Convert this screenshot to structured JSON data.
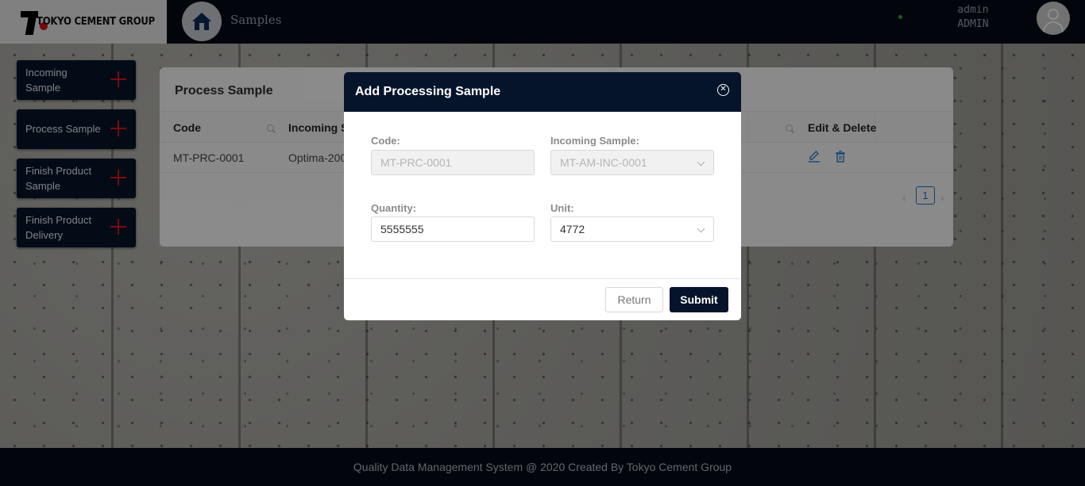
{
  "header": {
    "logo_text": "TOKYO CEMENT GROUP",
    "breadcrumb": "Samples",
    "user_name": "admin",
    "user_role": "ADMIN"
  },
  "sidebar": {
    "items": [
      {
        "label": "Incoming Sample"
      },
      {
        "label": "Process Sample"
      },
      {
        "label": "Finish Product Sample"
      },
      {
        "label": "Finish Product Delivery"
      }
    ]
  },
  "card": {
    "title": "Process Sample",
    "columns": [
      "Code",
      "Incoming S",
      "Edit & Delete"
    ],
    "rows": [
      {
        "code": "MT-PRC-0001",
        "incoming": "Optima-200"
      }
    ],
    "pagination": {
      "current_page": "1"
    }
  },
  "modal": {
    "title": "Add Processing Sample",
    "code_label": "Code:",
    "code_value": "MT-PRC-0001",
    "incoming_label": "Incoming Sample:",
    "incoming_value": "MT-AM-INC-0001",
    "quantity_label": "Quantity:",
    "quantity_value": "5555555",
    "unit_label": "Unit:",
    "unit_value": "4772",
    "return_label": "Return",
    "submit_label": "Submit"
  },
  "footer": {
    "text": "Quality Data Management System @ 2020 Created By Tokyo Cement Group"
  },
  "colors": {
    "navy": "#06142b",
    "accent_red": "#e0141e",
    "link_blue": "#1976d2"
  }
}
